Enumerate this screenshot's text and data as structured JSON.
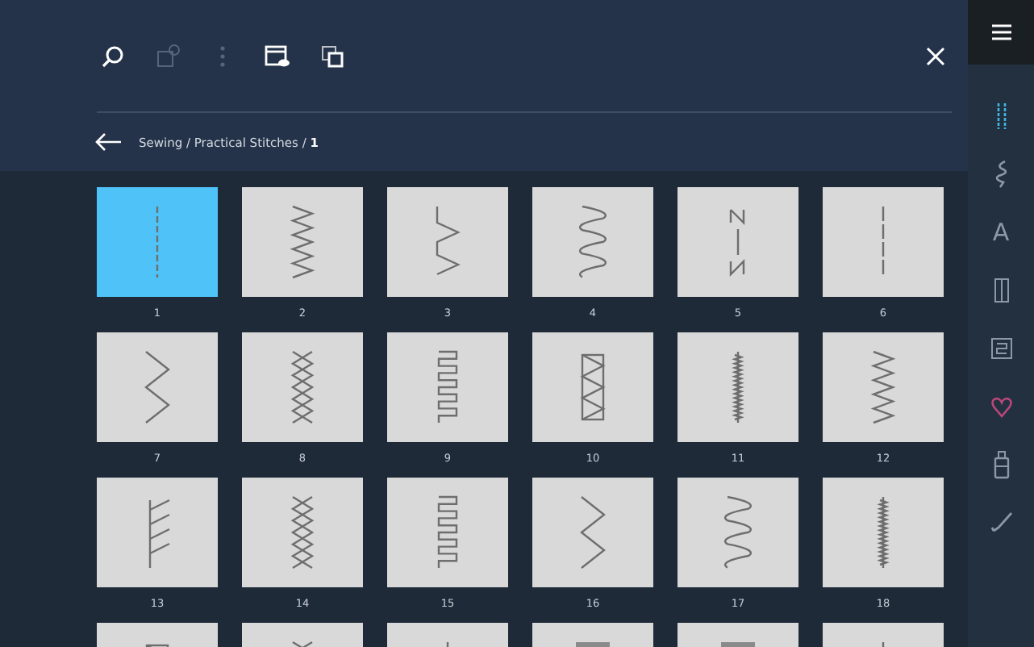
{
  "toolbar": [
    {
      "kind": "search",
      "disabled": false
    },
    {
      "kind": "add",
      "disabled": true
    },
    {
      "kind": "dots",
      "disabled": true
    },
    {
      "kind": "preview",
      "disabled": false
    },
    {
      "kind": "copy",
      "disabled": false
    }
  ],
  "breadcrumb": "Sewing / Practical Stitches / **1**",
  "stitches": [
    {
      "label": "1",
      "kind": "dashed",
      "selected": true
    },
    {
      "label": "2",
      "kind": "zigzag",
      "selected": false
    },
    {
      "label": "3",
      "kind": "blind",
      "selected": false
    },
    {
      "label": "4",
      "kind": "wave",
      "selected": false
    },
    {
      "label": "5",
      "kind": "bartack",
      "selected": false
    },
    {
      "label": "6",
      "kind": "triple",
      "selected": false
    },
    {
      "label": "7",
      "kind": "wide-zigzag",
      "selected": false
    },
    {
      "label": "8",
      "kind": "cross",
      "selected": false
    },
    {
      "label": "9",
      "kind": "square",
      "selected": false
    },
    {
      "label": "10",
      "kind": "triangle",
      "selected": false
    },
    {
      "label": "11",
      "kind": "overcast",
      "selected": false
    },
    {
      "label": "12",
      "kind": "zigzag",
      "selected": false
    },
    {
      "label": "13",
      "kind": "comb",
      "selected": false
    },
    {
      "label": "14",
      "kind": "cross",
      "selected": false
    },
    {
      "label": "15",
      "kind": "square",
      "selected": false
    },
    {
      "label": "16",
      "kind": "wide-zigzag",
      "selected": false
    },
    {
      "label": "17",
      "kind": "wave",
      "selected": false
    },
    {
      "label": "18",
      "kind": "overcast",
      "selected": false
    },
    {
      "kind": "triangle",
      "selected": false
    },
    {
      "kind": "cross",
      "selected": false
    },
    {
      "kind": "dashed",
      "selected": false
    },
    {
      "kind": "block",
      "selected": false
    },
    {
      "kind": "block",
      "selected": false
    },
    {
      "kind": "dashed",
      "selected": false
    }
  ],
  "sidebar": [
    {
      "kind": "stitch",
      "selected": true
    },
    {
      "kind": "serpentine",
      "selected": false
    },
    {
      "kind": "letter",
      "text": "A",
      "selected": false
    },
    {
      "kind": "column",
      "selected": false
    },
    {
      "kind": "quilt",
      "selected": false
    },
    {
      "kind": "heart",
      "selected": false
    },
    {
      "kind": "bobbin",
      "selected": false
    },
    {
      "kind": "pencil",
      "selected": false
    }
  ]
}
